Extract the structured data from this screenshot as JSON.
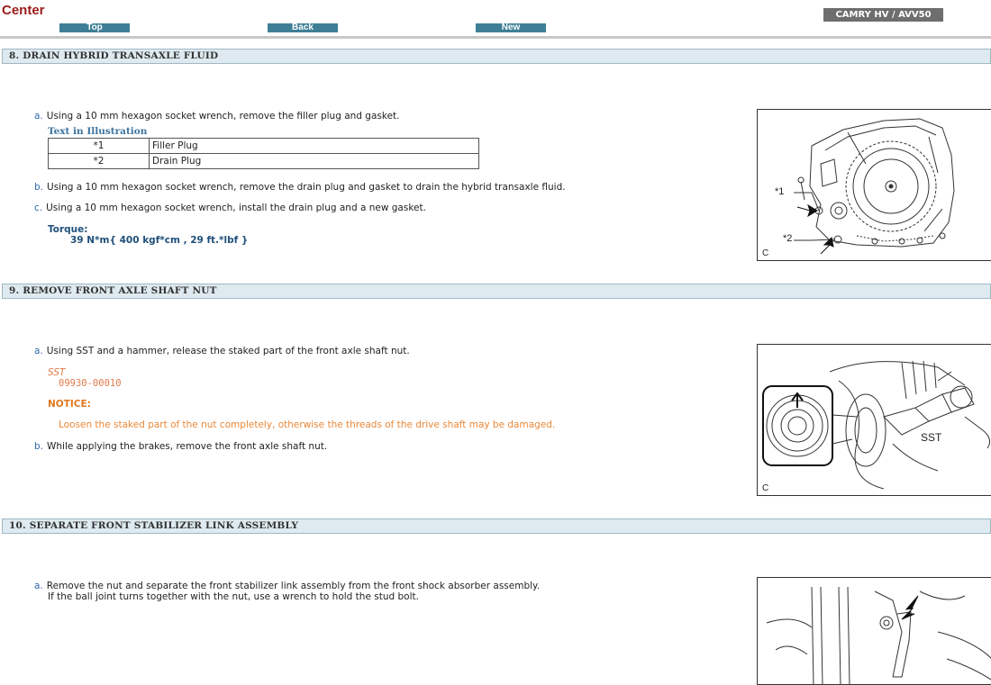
{
  "header": {
    "brand": "Center",
    "nav": {
      "top": "Top",
      "back": "Back",
      "new": "New"
    },
    "model": "CAMRY HV / AVV50"
  },
  "sections": {
    "s8": {
      "title": "8. DRAIN HYBRID TRANSAXLE FLUID",
      "step_a": {
        "letter": "a.",
        "text": "Using a 10 mm hexagon socket wrench, remove the filler plug and gasket."
      },
      "illustration": {
        "title": "Text in Illustration",
        "rows": [
          {
            "key": "*1",
            "value": "Filler Plug"
          },
          {
            "key": "*2",
            "value": "Drain Plug"
          }
        ]
      },
      "step_b": {
        "letter": "b.",
        "text": "Using a 10 mm hexagon socket wrench, remove the drain plug and gasket to drain the hybrid transaxle fluid."
      },
      "step_c": {
        "letter": "c.",
        "text": "Using a 10 mm hexagon socket wrench, install the drain plug and a new gasket."
      },
      "torque_label": "Torque:",
      "torque_value": "39 N*m{ 400 kgf*cm , 29 ft.*lbf }",
      "figure": {
        "label1": "*1",
        "label2": "*2",
        "caption": "C"
      }
    },
    "s9": {
      "title": "9. REMOVE FRONT AXLE SHAFT NUT",
      "step_a": {
        "letter": "a.",
        "text": "Using SST and a hammer, release the staked part of the front axle shaft nut."
      },
      "sst_label": "SST",
      "sst_value": "09930-00010",
      "notice_label": "NOTICE:",
      "notice_text": "Loosen the staked part of the nut completely, otherwise the threads of the drive shaft may be damaged.",
      "step_b": {
        "letter": "b.",
        "text": "While applying the brakes, remove the front axle shaft nut."
      },
      "figure": {
        "sst_label": "SST",
        "caption": "C"
      }
    },
    "s10": {
      "title": "10. SEPARATE FRONT STABILIZER LINK ASSEMBLY",
      "step_a": {
        "letter": "a.",
        "line1": "Remove the nut and separate the front stabilizer link assembly from the front shock absorber assembly.",
        "line2": "If the ball joint turns together with the nut, use a wrench to hold the stud bolt."
      }
    }
  }
}
